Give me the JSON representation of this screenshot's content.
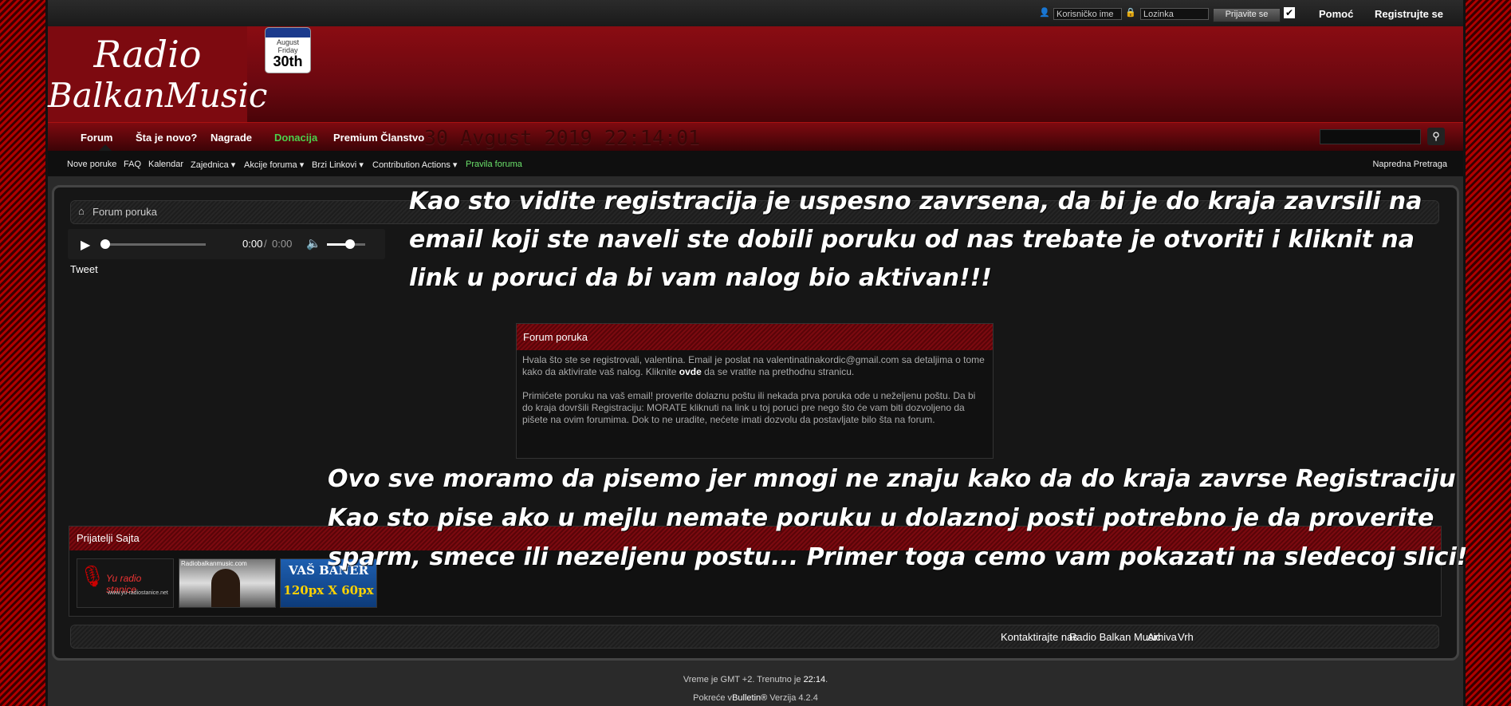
{
  "topbar": {
    "username_placeholder": "Korisničko ime",
    "password_placeholder": "Lozinka",
    "login_button": "Prijavite se",
    "help_link": "Pomoć",
    "register_link": "Registrujte se"
  },
  "header": {
    "logo_line1": "Radio",
    "logo_line2": "BalkanMusic",
    "calendar": {
      "month": "August",
      "weekday": "Friday",
      "day": "30th"
    }
  },
  "navbar": {
    "tabs": [
      "Forum",
      "Šta je novo?",
      "Nagrade",
      "Donacija",
      "Premium Članstvo"
    ],
    "clock": "30 Avgust 2019 22:14:01"
  },
  "subnav": {
    "items": [
      "Nove poruke",
      "FAQ",
      "Kalendar",
      "Zajednica",
      "Akcije foruma",
      "Brzi Linkovi",
      "Contribution Actions",
      "Pravila foruma"
    ],
    "advanced_search": "Napredna Pretraga"
  },
  "breadcrumb": "Forum poruka",
  "player": {
    "time": "0:00",
    "duration": "0:00",
    "volume_level": 0.6
  },
  "tweet": "Tweet",
  "overlay_top": [
    "Kao sto vidite registracija je uspesno zavrsena, da bi je do kraja zavrsili na",
    "email koji ste naveli ste dobili poruku od nas trebate je otvoriti i kliknit na",
    "link u poruci da bi vam nalog bio aktivan!!!"
  ],
  "message": {
    "title": "Forum poruka",
    "p1_a": "Hvala što ste se registrovali, valentina. Email je poslat na valentinatinakordic@gmail.com sa detaljima o tome kako da aktivirate vaš nalog. Kliknite ",
    "p1_link": "ovde",
    "p1_b": " da se vratite na prethodnu stranicu.",
    "p2": "Primićete poruku na vaš email! proverite dolaznu poštu ili nekada prva poruka ode u neželjenu poštu. Da bi do kraja dovršili Registraciju: MORATE kliknuti na link u toj poruci pre nego što će vam biti dozvoljeno da pišete na ovim forumima. Dok to ne uradite, nećete imati dozvolu da postavljate bilo šta na forum."
  },
  "overlay_bottom": [
    "Ovo sve moramo da pisemo jer mnogi ne znaju kako da do kraja zavrse Registraciju",
    "Kao sto pise ako u mejlu nemate poruku u dolaznoj posti potrebno je da proverite",
    "sparm, smece ili nezeljenu postu... Primer toga cemo vam pokazati na sledecoj slici!"
  ],
  "friends": {
    "title": "Prijatelji Sajta",
    "banner1": "Yu radio stanice",
    "banner1_url": "www.yu-radiostanice.net",
    "banner2": "Radiobalkanmusic.com",
    "banner3_l1": "VAŠ BANER",
    "banner3_l2": "120px X 60px"
  },
  "footer": {
    "links": [
      "Kontaktirajte nas",
      "Radio Balkan Music",
      "Arhiva",
      "Vrh"
    ]
  },
  "bottom": {
    "time_prefix": "Vreme je GMT +2. Trenutno je ",
    "time_value": "22:14",
    "time_suffix": ".",
    "powered_prefix": "Pokreće v",
    "powered_brand": "Bulletin®",
    "powered_suffix": " Verzija 4.2.4"
  },
  "colors": {
    "accent_red": "#7d0a10",
    "donation_green": "#4cd04c",
    "rules_green": "#6be26b"
  }
}
